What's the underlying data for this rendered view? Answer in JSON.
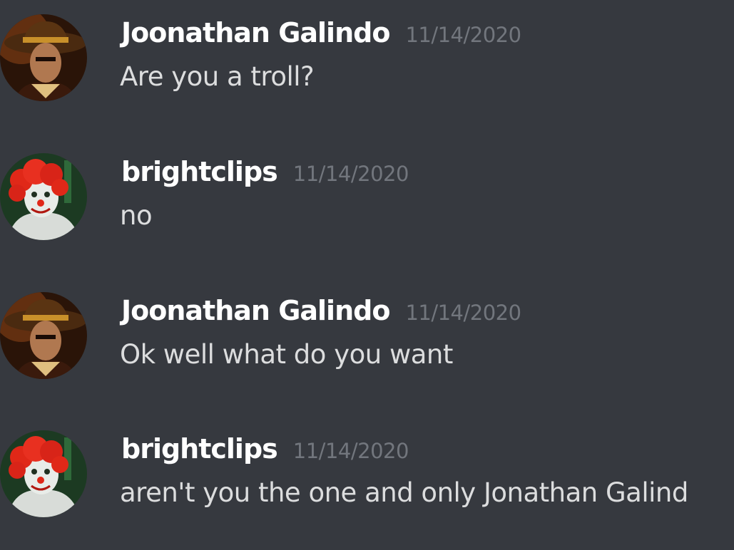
{
  "messages": [
    {
      "author": "Joonathan Galindo",
      "timestamp": "11/14/2020",
      "text": "Are you a troll?",
      "avatar_icon": "hat-man-avatar"
    },
    {
      "author": "brightclips",
      "timestamp": "11/14/2020",
      "text": "no",
      "avatar_icon": "clown-avatar"
    },
    {
      "author": "Joonathan Galindo",
      "timestamp": "11/14/2020",
      "text": "Ok well what do you want",
      "avatar_icon": "hat-man-avatar"
    },
    {
      "author": "brightclips",
      "timestamp": "11/14/2020",
      "text": "aren't you the one and only Jonathan Galind",
      "avatar_icon": "clown-avatar"
    }
  ],
  "colors": {
    "background": "#36393f",
    "username": "#ffffff",
    "timestamp": "#72767d",
    "message_text": "#dcddde"
  }
}
